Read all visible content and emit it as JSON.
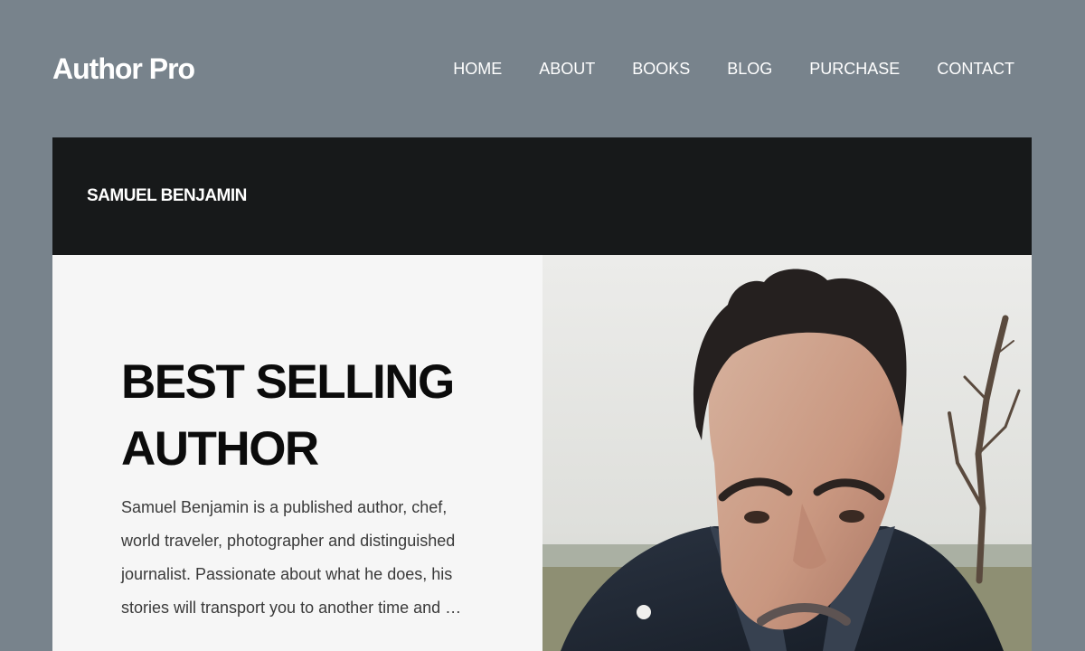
{
  "header": {
    "site_title": "Author Pro",
    "nav": [
      "HOME",
      "ABOUT",
      "BOOKS",
      "BLOG",
      "PURCHASE",
      "CONTACT"
    ]
  },
  "hero": {
    "author_name": "SAMUEL BENJAMIN",
    "headline": "BEST SELLING AUTHOR",
    "bio": "Samuel Benjamin is a published author, chef, world traveler, photographer and distinguished journalist. Passionate about what he does, his stories will transport you to another time and …"
  },
  "colors": {
    "page_background": "#78838c",
    "hero_bar": "#17191a",
    "intro_panel": "#f6f6f6"
  }
}
